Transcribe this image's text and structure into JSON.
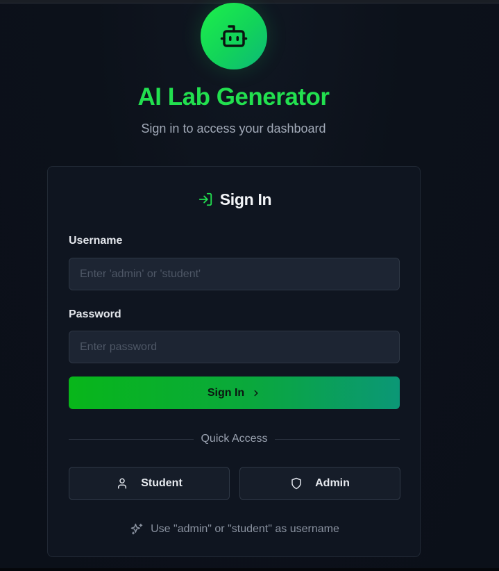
{
  "app": {
    "title": "AI Lab Generator",
    "subtitle": "Sign in to access your dashboard",
    "logo_icon": "robot-icon",
    "accent_color": "#22e04f"
  },
  "login_card": {
    "header_icon": "log-in-icon",
    "title": "Sign In",
    "username": {
      "label": "Username",
      "value": "",
      "placeholder": "Enter 'admin' or 'student'"
    },
    "password": {
      "label": "Password",
      "value": "",
      "placeholder": "Enter password"
    },
    "submit": {
      "label": "Sign In",
      "icon": "chevron-right-icon"
    },
    "quick_access": {
      "label": "Quick Access",
      "buttons": [
        {
          "label": "Student",
          "icon": "user-icon"
        },
        {
          "label": "Admin",
          "icon": "shield-icon"
        }
      ]
    },
    "hint": {
      "icon": "sparkles-icon",
      "text": "Use \"admin\" or \"student\" as username"
    }
  }
}
